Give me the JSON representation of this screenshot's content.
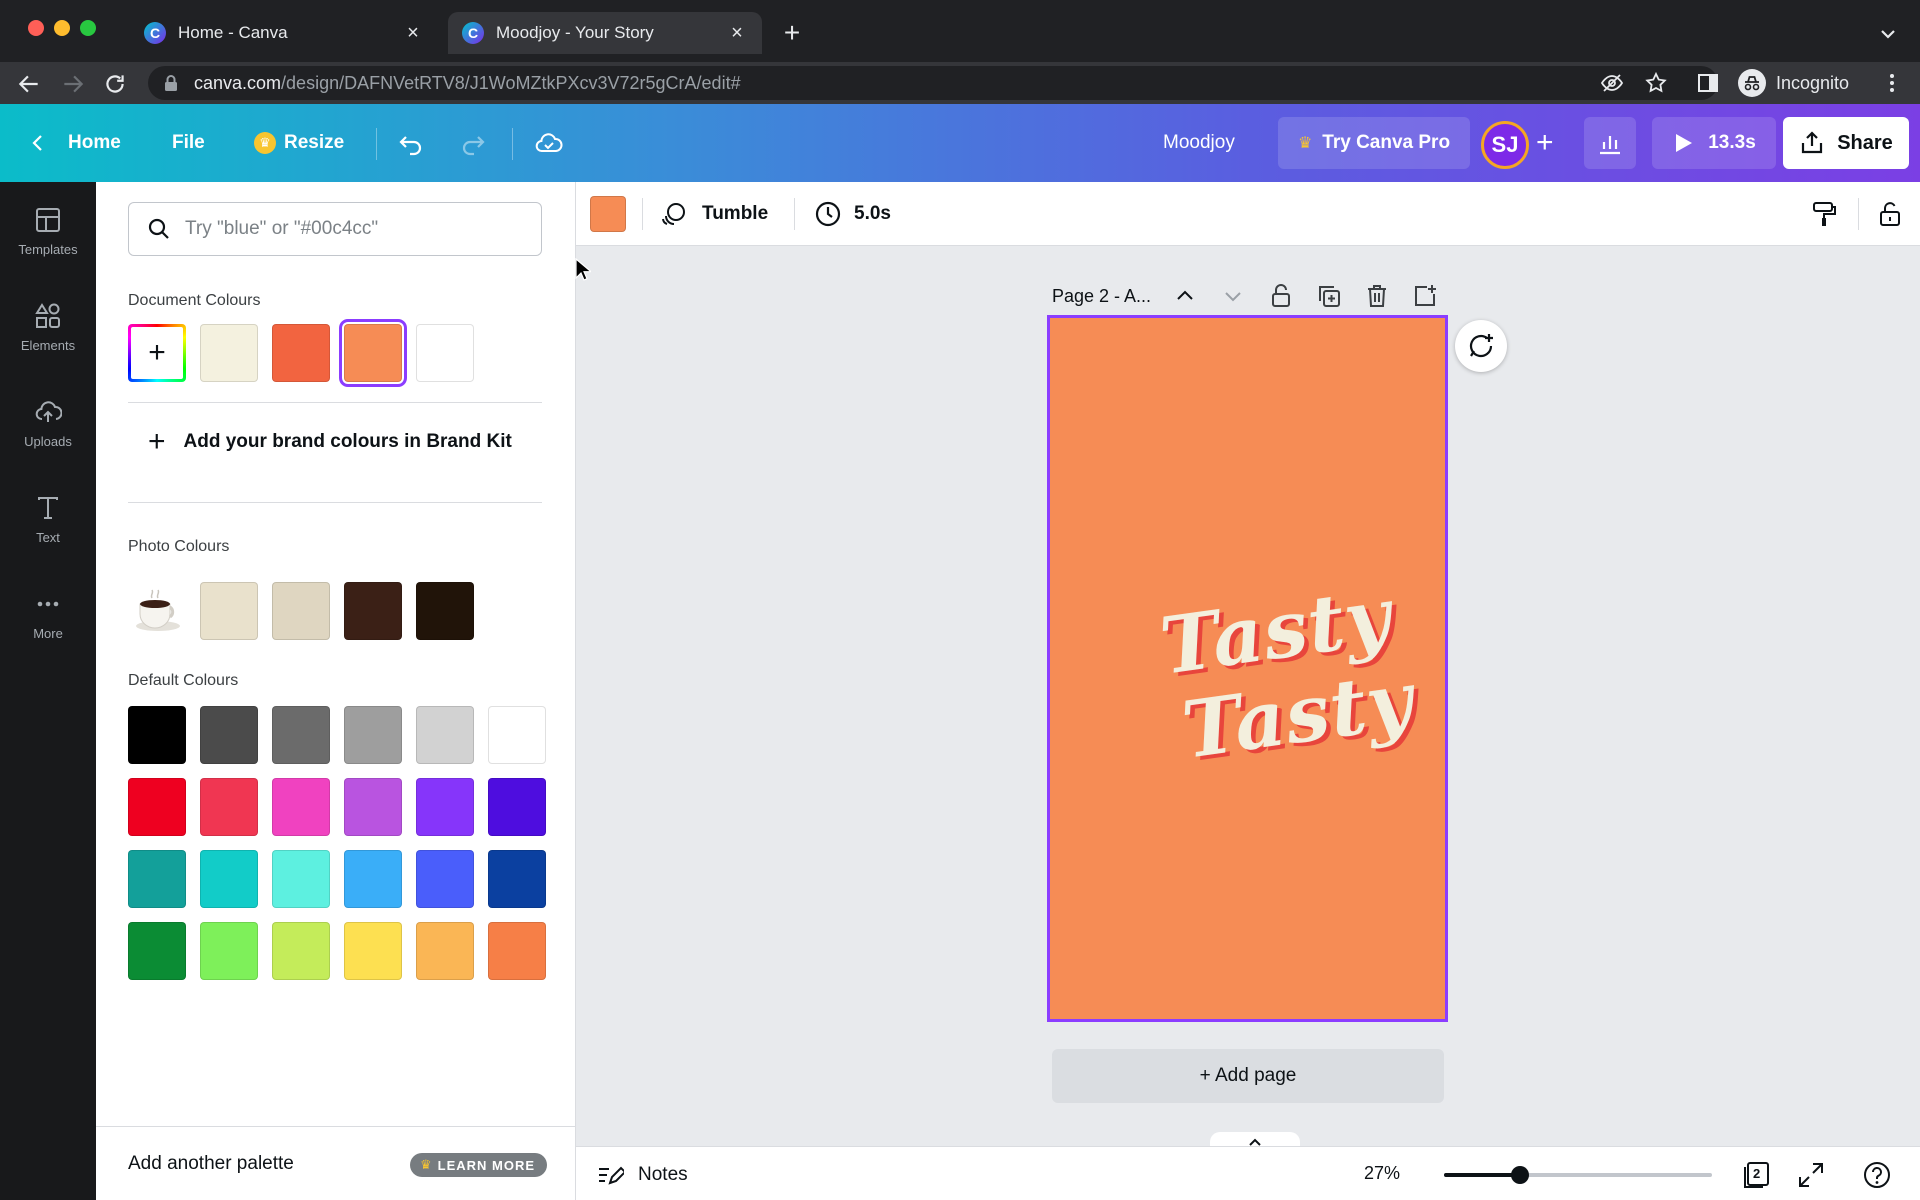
{
  "browser": {
    "tabs": [
      {
        "title": "Home - Canva",
        "active": false
      },
      {
        "title": "Moodjoy - Your Story",
        "active": true
      }
    ],
    "url_host": "canva.com",
    "url_path": "/design/DAFNVetRTV8/J1WoMZtkPXcv3V72r5gCrA/edit#",
    "profile": "Incognito",
    "favicon_letter": "C"
  },
  "header": {
    "home": "Home",
    "file": "File",
    "resize": "Resize",
    "design_name": "Moodjoy",
    "try_pro": "Try Canva Pro",
    "avatar": "SJ",
    "duration": "13.3s",
    "share": "Share"
  },
  "rail": [
    {
      "label": "Templates",
      "icon": "templates-icon"
    },
    {
      "label": "Elements",
      "icon": "elements-icon"
    },
    {
      "label": "Uploads",
      "icon": "uploads-icon"
    },
    {
      "label": "Text",
      "icon": "text-icon"
    },
    {
      "label": "More",
      "icon": "more-icon"
    }
  ],
  "panel": {
    "search_placeholder": "Try \"blue\" or \"#00c4cc\"",
    "document_title": "Document Colours",
    "document_colours": [
      "#f4f1df",
      "#f26440",
      "#f68c55",
      "#ffffff"
    ],
    "brand_kit": "Add your brand colours in Brand Kit",
    "photo_title": "Photo Colours",
    "photo_colours": [
      "#e9e1cc",
      "#dfd6c1",
      "#3b2016",
      "#211409"
    ],
    "default_title": "Default Colours",
    "default_colours": [
      [
        "#000000",
        "#4b4b4b",
        "#6b6b6b",
        "#9e9e9e",
        "#d2d2d2",
        "#ffffff"
      ],
      [
        "#ee0020",
        "#f03652",
        "#f042c0",
        "#b954e0",
        "#8635fa",
        "#4e0ddf"
      ],
      [
        "#13a09a",
        "#12ccc8",
        "#5df0e0",
        "#3aaef8",
        "#4a5efb",
        "#0b40a0"
      ],
      [
        "#0b8c34",
        "#7ef05a",
        "#c4ec5a",
        "#fde051",
        "#fab655",
        "#f67f47"
      ]
    ],
    "footer_label": "Add another palette",
    "learn_more": "LEARN MORE"
  },
  "toolbar": {
    "animation": "Tumble",
    "duration": "5.0s",
    "fill_color": "#f68c55"
  },
  "canvas": {
    "page_label": "Page 2 - A...",
    "text_line1": "Tasty",
    "text_line2": "Tasty",
    "background": "#f68c55",
    "add_page": "+ Add page"
  },
  "bottom": {
    "notes": "Notes",
    "zoom": "27%",
    "zoom_level": 0.27,
    "page_count": "2"
  },
  "colors": {
    "accent": "#8b3dff",
    "header_start": "#0bbcc9",
    "header_end": "#7b3fe4"
  }
}
